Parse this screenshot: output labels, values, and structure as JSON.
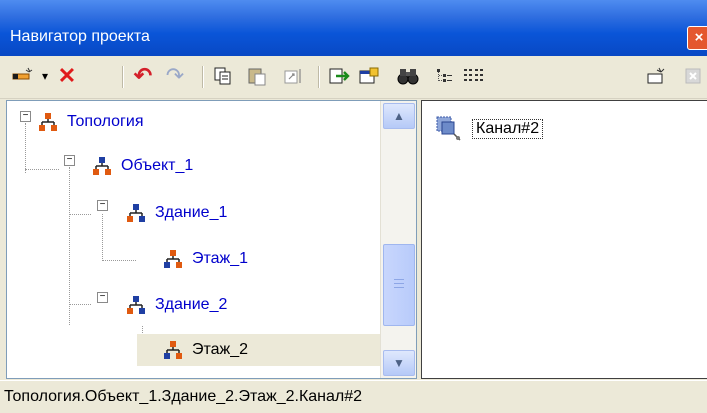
{
  "window": {
    "title": "Навигатор проекта",
    "close_glyph": "×"
  },
  "toolbar": {
    "buttons": [
      {
        "name": "new-element-button",
        "icon": "wand-icon"
      },
      {
        "name": "dropdown-button",
        "icon": "chevron-down-icon",
        "glyph": "▾"
      },
      {
        "name": "delete-button",
        "icon": "red-x-icon",
        "glyph": "✕"
      },
      {
        "name": "undo-button",
        "icon": "undo-icon",
        "glyph": "↶"
      },
      {
        "name": "redo-button",
        "icon": "redo-icon",
        "glyph": "↷"
      },
      {
        "name": "copy-button",
        "icon": "copy-icon"
      },
      {
        "name": "paste-button",
        "icon": "paste-icon"
      },
      {
        "name": "resize-button",
        "icon": "resize-icon"
      },
      {
        "name": "import-button",
        "icon": "import-icon"
      },
      {
        "name": "properties-button",
        "icon": "properties-icon"
      },
      {
        "name": "find-button",
        "icon": "binoculars-icon"
      },
      {
        "name": "tree-view-button",
        "icon": "tree-view-icon"
      },
      {
        "name": "list-view-button",
        "icon": "list-view-icon"
      },
      {
        "name": "new-wand-button",
        "icon": "wand-icon"
      },
      {
        "name": "disabled-close-button",
        "icon": "close-icon"
      }
    ]
  },
  "tree": {
    "nodes": [
      {
        "label": "Топология",
        "expander": "−"
      },
      {
        "label": "Объект_1",
        "expander": "−"
      },
      {
        "label": "Здание_1",
        "expander": "−"
      },
      {
        "label": "Этаж_1"
      },
      {
        "label": "Здание_2",
        "expander": "−"
      },
      {
        "label": "Этаж_2",
        "selected": true
      }
    ],
    "scroll_up": "▲",
    "scroll_down": "▼"
  },
  "content": {
    "items": [
      {
        "label": "Канал#2",
        "icon": "channel-icon"
      }
    ]
  },
  "status": {
    "path": "Топология.Объект_1.Здание_2.Этаж_2.Канал#2"
  },
  "colors": {
    "title_blue": "#0a55d8",
    "node_text": "#0000cc",
    "delete_red": "#e01b1b",
    "undo_red": "#d4202a",
    "icon_orange": "#e05a10",
    "icon_blue": "#1f3fa3"
  }
}
